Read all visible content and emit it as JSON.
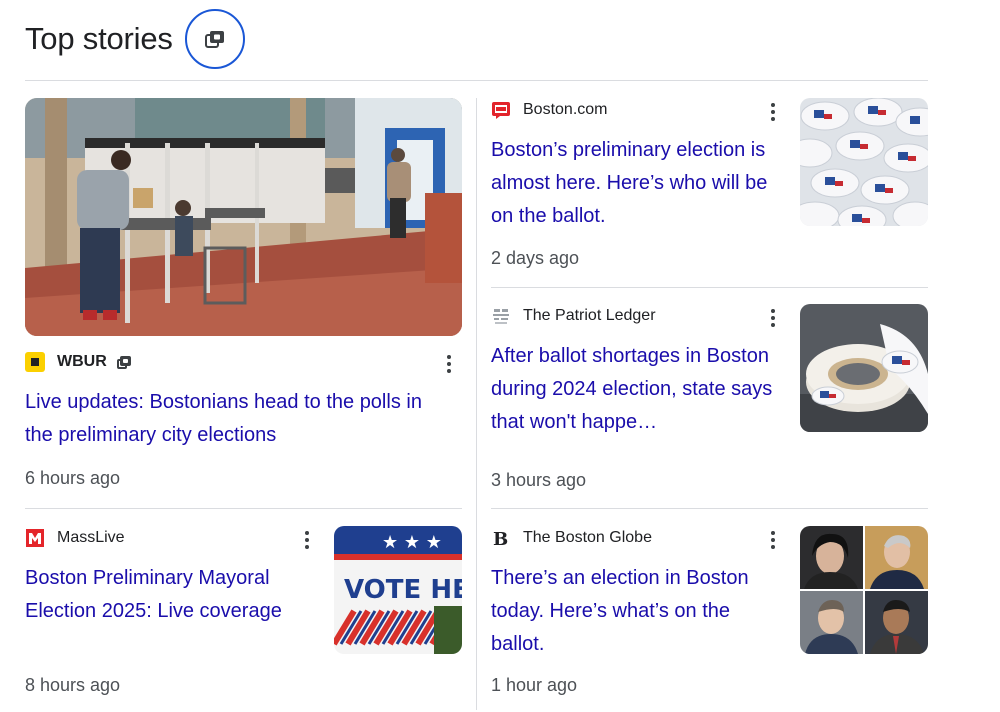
{
  "header": {
    "title": "Top stories",
    "button_icon": "full-coverage-icon"
  },
  "stories": [
    {
      "source": "WBUR",
      "headline": "Live updates: Bostonians head to the polls in the preliminary city elections",
      "time": "6 hours ago",
      "logo_icon": "wbur-logo",
      "image": "polling-station-photo"
    },
    {
      "source": "Boston.com",
      "headline": "Boston’s preliminary election is almost here. Here’s who will be on the ballot.",
      "time": "2 days ago",
      "logo_icon": "boston-com-logo",
      "image": "i-voted-stickers-photo"
    },
    {
      "source": "The Patriot Ledger",
      "headline": "After ballot shortages in Boston during 2024 election, state says that won't happe…",
      "time": "3 hours ago",
      "logo_icon": "patriot-ledger-logo",
      "image": "i-voted-sticker-roll-photo"
    },
    {
      "source": "MassLive",
      "headline": "Boston Preliminary Mayoral Election 2025: Live coverage",
      "time": "8 hours ago",
      "logo_icon": "masslive-logo",
      "image": "vote-here-sign-photo",
      "image_text": "VOTE HERE"
    },
    {
      "source": "The Boston Globe",
      "headline": "There’s an election in Boston today. Here’s what’s on the ballot.",
      "time": "1 hour ago",
      "logo_icon": "boston-globe-logo",
      "image": "candidates-headshots-photo"
    }
  ],
  "colors": {
    "link": "#1a0dab",
    "accent": "#1a57d6",
    "wbur_yellow": "#fbd000",
    "masslive_red": "#e4252a",
    "boston_com_red": "#e2242b"
  }
}
